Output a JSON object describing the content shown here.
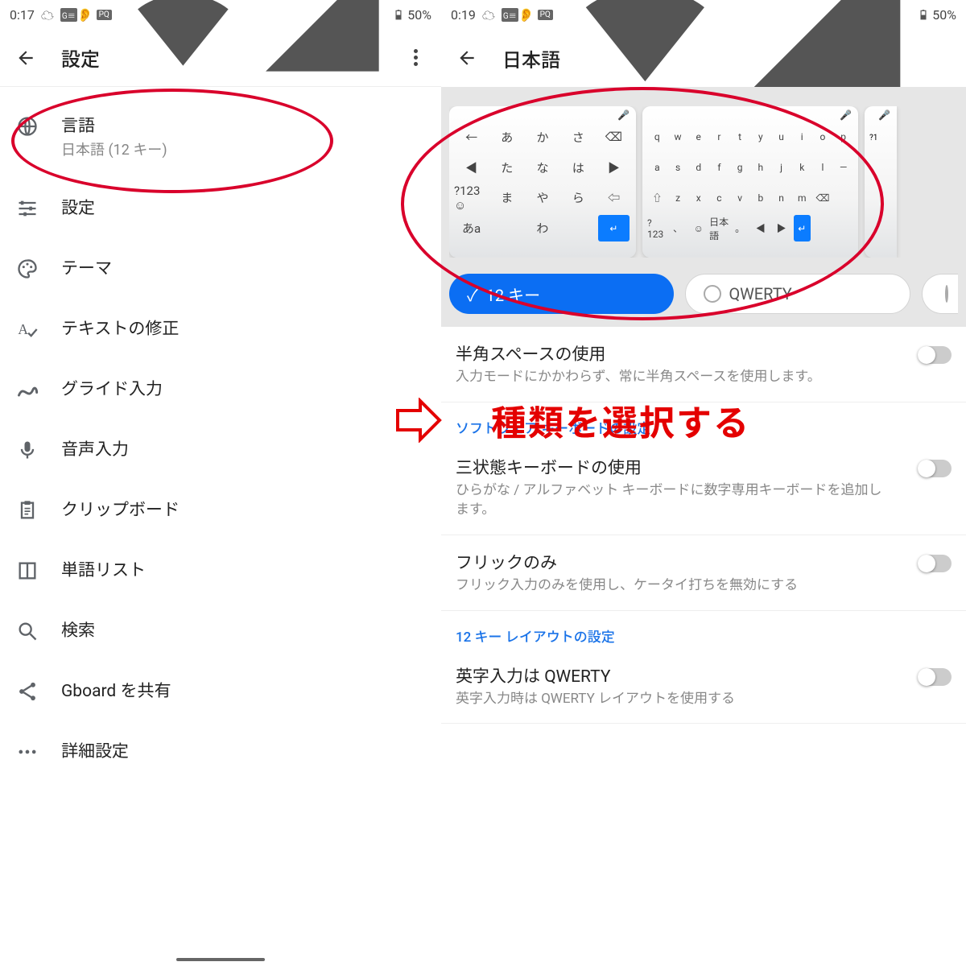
{
  "left": {
    "status": {
      "time": "0:17",
      "battery": "50%"
    },
    "title": "設定",
    "items": [
      {
        "icon": "globe",
        "title": "言語",
        "sub": "日本語 (12 キー)"
      },
      {
        "icon": "sliders",
        "title": "設定"
      },
      {
        "icon": "palette",
        "title": "テーマ"
      },
      {
        "icon": "spellcheck",
        "title": "テキストの修正"
      },
      {
        "icon": "swoosh",
        "title": "グライド入力"
      },
      {
        "icon": "mic",
        "title": "音声入力"
      },
      {
        "icon": "clipboard",
        "title": "クリップボード"
      },
      {
        "icon": "wordlist",
        "title": "単語リスト"
      },
      {
        "icon": "search",
        "title": "検索"
      },
      {
        "icon": "share",
        "title": "Gboard を共有"
      },
      {
        "icon": "more",
        "title": "詳細設定"
      }
    ]
  },
  "right": {
    "status": {
      "time": "0:19",
      "battery": "50%"
    },
    "title": "日本語",
    "layouts": [
      {
        "label": "12 キー",
        "selected": true
      },
      {
        "label": "QWERTY",
        "selected": false
      }
    ],
    "kb12_keys": [
      [
        "←",
        "あ",
        "か",
        "さ",
        "⌫"
      ],
      [
        "◀",
        "た",
        "な",
        "は",
        "▶"
      ],
      [
        "?123 ☺",
        "ま",
        "や",
        "ら",
        "⇦"
      ],
      [
        "あa",
        "",
        "わ",
        "",
        "↵"
      ]
    ],
    "kbqw_keys": [
      [
        "q",
        "w",
        "e",
        "r",
        "t",
        "y",
        "u",
        "i",
        "o",
        "p"
      ],
      [
        "a",
        "s",
        "d",
        "f",
        "g",
        "h",
        "j",
        "k",
        "l",
        "—"
      ],
      [
        "⇧",
        "z",
        "x",
        "c",
        "v",
        "b",
        "n",
        "m",
        "⌫",
        ""
      ],
      [
        "?123",
        "、",
        "☺",
        "日本語",
        "。",
        "◀",
        "▶",
        "↵",
        "",
        ""
      ]
    ],
    "settings": [
      {
        "type": "toggle",
        "title": "半角スペースの使用",
        "sub": "入力モードにかかわらず、常に半角スペースを使用します。"
      },
      {
        "type": "header",
        "title": "ソフトウェア キーボードの設定"
      },
      {
        "type": "toggle",
        "title": "三状態キーボードの使用",
        "sub": "ひらがな / アルファベット キーボードに数字専用キーボードを追加します。"
      },
      {
        "type": "toggle",
        "title": "フリックのみ",
        "sub": "フリック入力のみを使用し、ケータイ打ちを無効にする"
      },
      {
        "type": "header",
        "title": "12 キー レイアウトの設定"
      },
      {
        "type": "toggle",
        "title": "英字入力は QWERTY",
        "sub": "英字入力時は QWERTY レイアウトを使用する"
      }
    ]
  },
  "annotation": {
    "text": "種類を選択する"
  }
}
